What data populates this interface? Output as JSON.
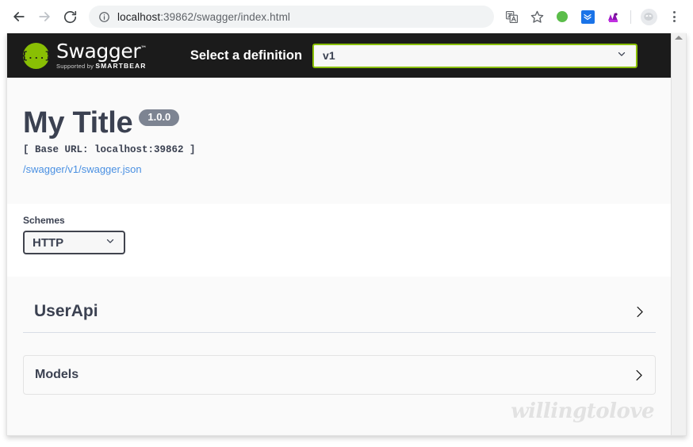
{
  "browser": {
    "back_icon": "arrow-left-icon",
    "forward_icon": "arrow-right-icon",
    "reload_icon": "reload-icon",
    "site_info_icon": "info-circle-icon",
    "url_host": "localhost",
    "url_path": ":39862/swagger/index.html",
    "url_full": "localhost:39862/swagger/index.html",
    "toolbar_icons": [
      "translate-icon",
      "bookmark-star-icon",
      "extension-green-icon",
      "extension-blue-icon",
      "extension-purple-icon",
      "profile-avatar-icon",
      "more-options-icon"
    ]
  },
  "topbar": {
    "logo_mark": "{...}",
    "logo_word": "Swagger",
    "logo_tm": "™",
    "logo_sub_prefix": "Supported by",
    "logo_sub_brand": "SMARTBEAR",
    "definition_label": "Select a definition",
    "definition_value": "v1",
    "definition_chevron": "chevron-down-icon",
    "accent_color": "#89bf04",
    "background_color": "#1b1b1b"
  },
  "info": {
    "title": "My Title",
    "version": "1.0.0",
    "base_url": "[ Base URL: localhost:39862 ]",
    "spec_link": "/swagger/v1/swagger.json",
    "link_color": "#4a90e2",
    "badge_color": "#7d8492"
  },
  "schemes": {
    "label": "Schemes",
    "value": "HTTP",
    "chevron": "chevron-down-icon"
  },
  "sections": [
    {
      "name": "UserApi",
      "expand_icon": "chevron-right-icon"
    }
  ],
  "models": {
    "name": "Models",
    "expand_icon": "chevron-right-icon"
  },
  "watermark": {
    "text": "willingtolove"
  },
  "scrollbar": {
    "up_arrow_icon": "scroll-up-arrow-icon"
  }
}
